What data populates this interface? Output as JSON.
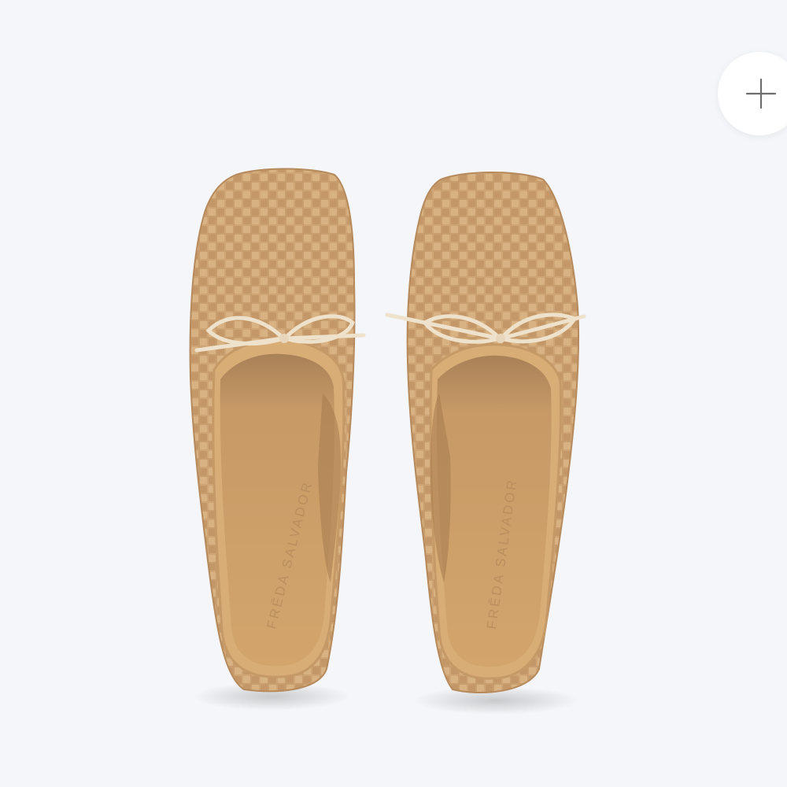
{
  "product_image": {
    "alt": "Woven leather ballet flats with bow, top view",
    "shoe_brand_stamp": "FRĒDA SALVADOR"
  },
  "controls": {
    "zoom_icon": "plus-icon"
  },
  "colors": {
    "background": "#f4f6f9",
    "leather": "#cfa575",
    "leather_dark": "#b78a58",
    "insole": "#c99a64",
    "lace": "#efe2cc"
  }
}
